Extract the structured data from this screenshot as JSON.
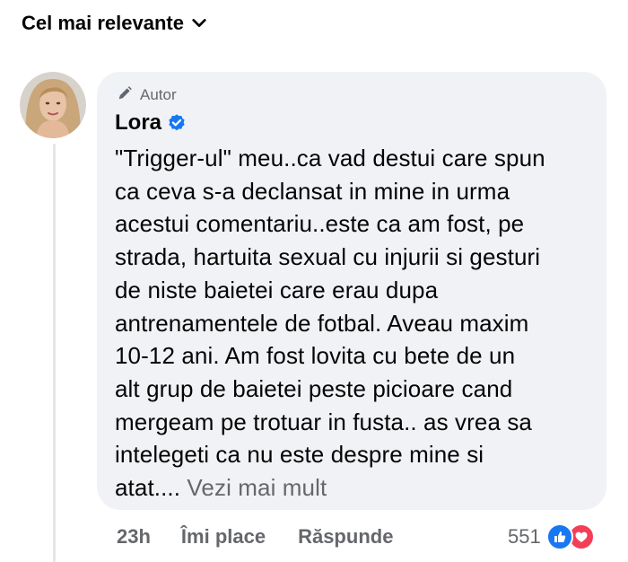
{
  "sort": {
    "label": "Cel mai relevante",
    "icon": "chevron-down-icon"
  },
  "comment": {
    "badge": "Autor",
    "badge_icon": "pencil-icon",
    "author": "Lora",
    "verified_icon": "verified-badge-icon",
    "text": "\"Trigger-ul\" meu..ca vad destui care spun\nca ceva s-a declansat in mine in urma\nacestui comentariu..este ca am fost, pe\nstrada, hartuita sexual cu injurii si gesturi\nde niste baietei care erau dupa\nantrenamentele de fotbal. Aveau maxim\n10-12 ani. Am fost lovita cu bete de un\nalt grup de baietei peste picioare cand\nmergeam pe trotuar in fusta.. as vrea sa\nintelegeti ca nu este despre mine si\natat.",
    "ellipsis": "...",
    "see_more": "Vezi mai mult"
  },
  "actions": {
    "time": "23h",
    "like": "Îmi place",
    "reply": "Răspunde",
    "reaction_count": "551",
    "reaction_icons": [
      "like-reaction-icon",
      "love-reaction-icon"
    ]
  },
  "colors": {
    "bubble": "#f0f2f5",
    "secondary_text": "#65676b",
    "like_blue": "#1877f2",
    "love_red": "#f33e58"
  }
}
